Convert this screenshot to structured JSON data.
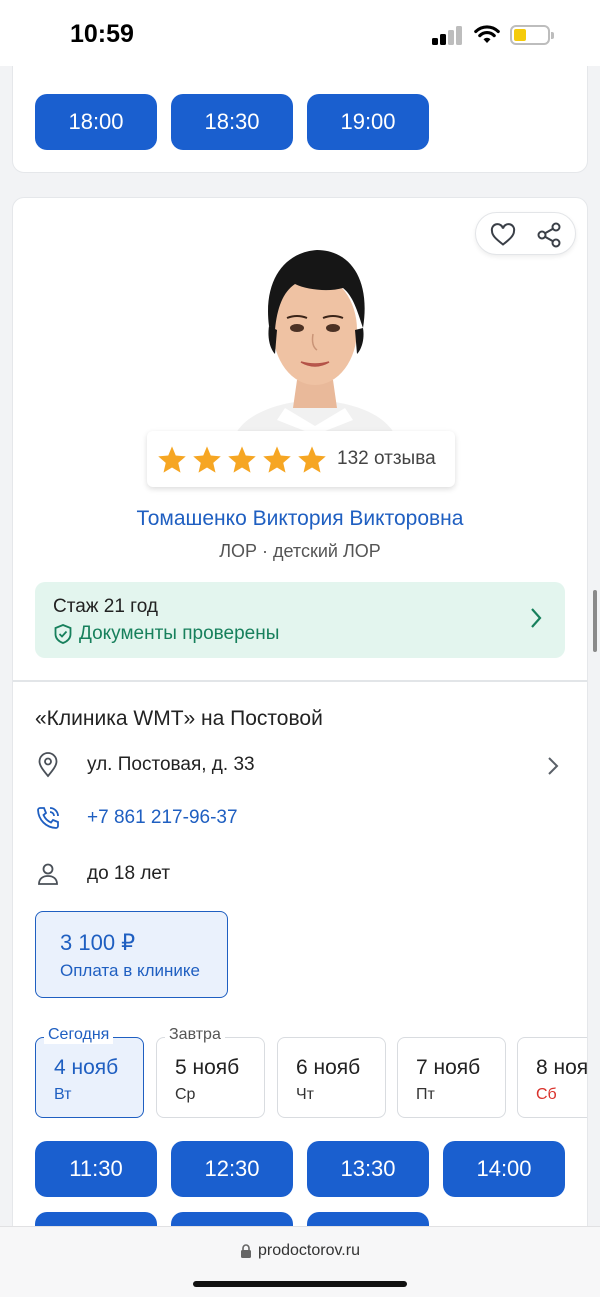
{
  "status": {
    "time": "10:59"
  },
  "top_card": {
    "slots": [
      "18:00",
      "18:30",
      "19:00"
    ]
  },
  "doctor": {
    "reviews": "132 отзыва",
    "rating_stars": 5,
    "name": "Томашенко Виктория Викторовна",
    "specialty": "ЛОР · детский ЛОР",
    "experience": "Стаж 21 год",
    "documents": "Документы проверены"
  },
  "clinic": {
    "name": "«Клиника WMT» на Постовой",
    "address": "ул. Постовая, д. 33",
    "phone": "+7 861 217-96-37",
    "age": "до 18 лет",
    "price": "3 100 ₽",
    "price_note": "Оплата в клинике"
  },
  "days": [
    {
      "tag": "Сегодня",
      "date": "4 нояб",
      "weekday": "Вт"
    },
    {
      "tag": "Завтра",
      "date": "5 нояб",
      "weekday": "Ср"
    },
    {
      "tag": "",
      "date": "6 нояб",
      "weekday": "Чт"
    },
    {
      "tag": "",
      "date": "7 нояб",
      "weekday": "Пт"
    },
    {
      "tag": "",
      "date": "8 ноя",
      "weekday": "Сб"
    }
  ],
  "slots": [
    "11:30",
    "12:30",
    "13:30",
    "14:00"
  ],
  "browser": {
    "url": "prodoctorov.ru"
  },
  "colors": {
    "accent": "#1a5fcf",
    "link": "#1f5fc1",
    "verified": "#17805c",
    "star": "#f6a623",
    "weekend": "#d9312b"
  }
}
